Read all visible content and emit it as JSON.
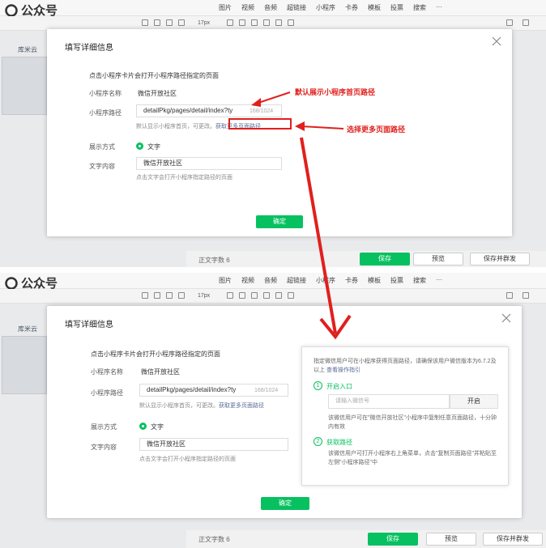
{
  "app": {
    "name": "公众号"
  },
  "menu": [
    "图片",
    "视频",
    "音频",
    "超链接",
    "小程序",
    "卡券",
    "模板",
    "投票",
    "搜索",
    "···"
  ],
  "toolbar": {
    "font_size": "17px"
  },
  "sidebar": {
    "label": "库米云"
  },
  "bottom": {
    "word_count": "正文字数 6",
    "save": "保存",
    "preview": "预览",
    "save_send": "保存并群发"
  },
  "dialog": {
    "title": "填写详细信息",
    "hint": "点击小程序卡片会打开小程序路径指定的页面",
    "name_label": "小程序名称",
    "name_value": "微信开放社区",
    "path_label": "小程序路径",
    "path_value": "detailPkg/pages/detail/index?ty",
    "path_count": "168/1024",
    "path_note": "默认显示小程序首页，可更改。",
    "path_link": "获取更多页面路径",
    "display_label": "展示方式",
    "display_option": "文字",
    "text_label": "文字内容",
    "text_value": "微信开放社区",
    "text_note": "点击文字会打开小程序指定路径的页面",
    "confirm": "确定"
  },
  "annotations": {
    "default_path": "默认展示小程序首页路径",
    "more_paths": "选择更多页面路径"
  },
  "popover": {
    "intro": "指定微信用户可在小程序获得页面路径，请确保该用户微信版本为6.7.2及以上",
    "guide_link": "查看操作指引",
    "step1_num": "1",
    "step1_title": "开启入口",
    "step1_placeholder": "请输入微信号",
    "step1_button": "开启",
    "step1_desc": "该微信用户可在\"微信开放社区\"小程序中复制任意页面路径，十分钟内有效",
    "step2_num": "2",
    "step2_title": "获取路径",
    "step2_desc": "该微信用户可打开小程序右上角菜单，点击\"复制页面路径\"并粘贴至左侧\"小程序路径\"中"
  },
  "colors": {
    "brand_green": "#07c160",
    "annotation_red": "#e0201c",
    "link_blue": "#576b95"
  }
}
